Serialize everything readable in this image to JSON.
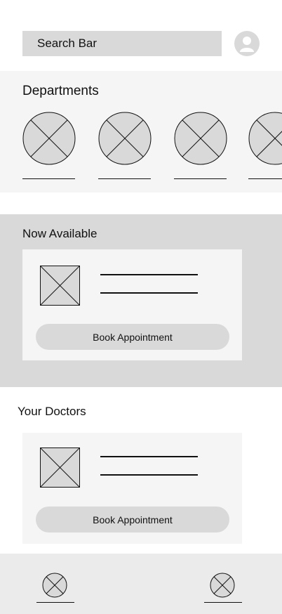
{
  "header": {
    "search_label": "Search Bar",
    "avatar_icon": "user-avatar-icon"
  },
  "departments": {
    "title": "Departments",
    "items": [
      {
        "icon": "image-placeholder-icon"
      },
      {
        "icon": "image-placeholder-icon"
      },
      {
        "icon": "image-placeholder-icon"
      },
      {
        "icon": "image-placeholder-icon"
      }
    ]
  },
  "now_available": {
    "title": "Now Available",
    "card": {
      "button_label": "Book Appointment",
      "thumb_icon": "image-placeholder-icon"
    }
  },
  "your_doctors": {
    "title": "Your Doctors",
    "card": {
      "button_label": "Book Appointment",
      "thumb_icon": "image-placeholder-icon"
    }
  },
  "bottom_nav": {
    "items": [
      {
        "icon": "image-placeholder-icon"
      },
      {
        "icon": "image-placeholder-icon"
      }
    ]
  },
  "colors": {
    "placeholder_gray": "#d9d9d9",
    "section_light": "#f5f5f5",
    "nav_bg": "#ebebeb"
  }
}
